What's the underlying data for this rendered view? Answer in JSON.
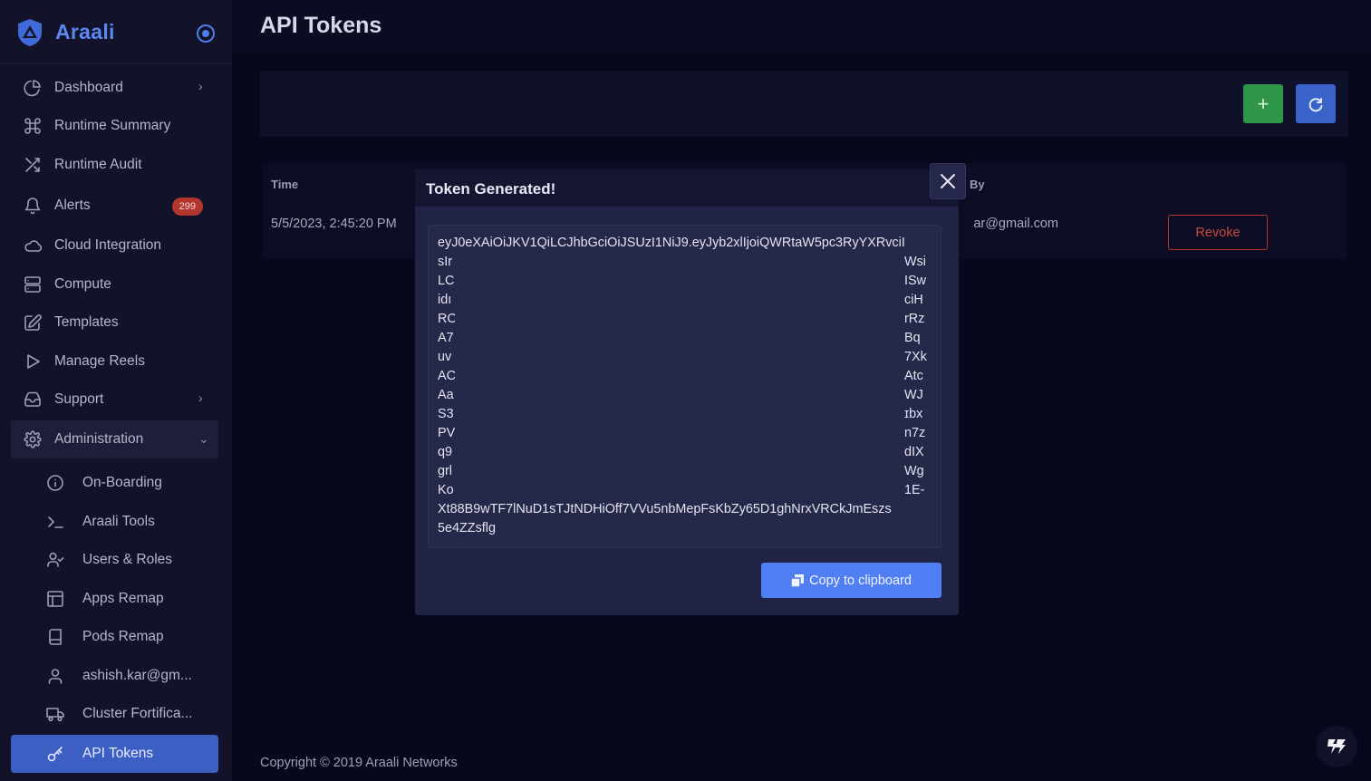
{
  "brand": {
    "name": "Araali"
  },
  "page": {
    "title": "API Tokens"
  },
  "sidebar": {
    "items": [
      {
        "label": "Dashboard",
        "icon": "pie-chart-icon"
      },
      {
        "label": "Runtime Summary",
        "icon": "command-icon"
      },
      {
        "label": "Runtime Audit",
        "icon": "shuffle-icon"
      },
      {
        "label": "Alerts",
        "icon": "bell-icon",
        "badge": "299"
      },
      {
        "label": "Cloud Integration",
        "icon": "cloud-icon"
      },
      {
        "label": "Compute",
        "icon": "server-icon"
      },
      {
        "label": "Templates",
        "icon": "edit-icon"
      },
      {
        "label": "Manage Reels",
        "icon": "play-icon"
      },
      {
        "label": "Support",
        "icon": "inbox-icon"
      },
      {
        "label": "Administration",
        "icon": "gear-icon"
      }
    ],
    "subitems": [
      {
        "label": "On-Boarding",
        "icon": "info-icon"
      },
      {
        "label": "Araali Tools",
        "icon": "terminal-icon"
      },
      {
        "label": "Users & Roles",
        "icon": "user-check-icon"
      },
      {
        "label": "Apps Remap",
        "icon": "layout-icon"
      },
      {
        "label": "Pods Remap",
        "icon": "book-icon"
      },
      {
        "label": "ashish.kar@gm...",
        "icon": "user-icon"
      },
      {
        "label": "Cluster Fortifica...",
        "icon": "truck-icon"
      },
      {
        "label": "API Tokens",
        "icon": "key-icon"
      }
    ]
  },
  "table": {
    "headers": {
      "time": "Time",
      "by": "By"
    },
    "rows": [
      {
        "time": "5/5/2023, 2:45:20 PM",
        "by": "ar@gmail.com",
        "action": "Revoke"
      }
    ]
  },
  "toolbar": {
    "add_label": "+",
    "refresh_icon": "refresh-icon"
  },
  "modal": {
    "title": "Token Generated!",
    "close_label": "×",
    "copy_label": "Copy to clipboard",
    "token_lines": [
      "eyJ0eXAiOiJKV1QiLCJhbGciOiJSUzI1NiJ9.eyJyb2xlIjoiQWRtaW5pc3RyYXRvciI",
      "sIr",
      "LC",
      "idı",
      "RC",
      "A7",
      "uv",
      "AC",
      "Aa",
      "S3",
      "PV",
      "q9",
      "grl",
      "Ko",
      "Xt88B9wTF7lNuD1sTJtNDHiOff7VVu5nbMepFsKbZy65D1ghNrxVRCkJmEszs",
      "5e4ZZsflg"
    ],
    "token_right": [
      "",
      "Wsi",
      "ISw",
      "ciH",
      "rRz",
      "Bq",
      "7Xk",
      "Atc",
      "WJ",
      "ɪbx",
      "n7z",
      "dIX",
      "Wg",
      "1E-",
      "",
      ""
    ]
  },
  "footer": {
    "copyright": "Copyright © 2019 Araali Networks"
  },
  "colors": {
    "accent": "#4f7ff2",
    "add_button": "#2f9547",
    "danger": "#b3362c",
    "sidebar_bg": "#12132a",
    "page_bg": "#07081c"
  }
}
